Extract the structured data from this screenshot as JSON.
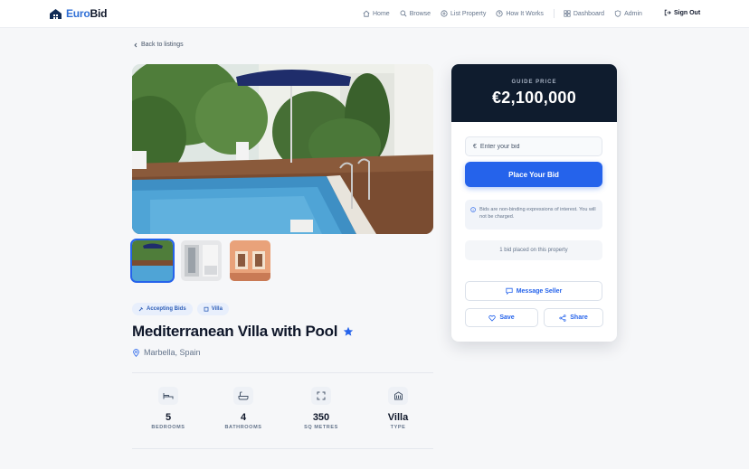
{
  "header": {
    "logo_euro": "Euro",
    "logo_bid": "Bid",
    "nav": [
      {
        "label": "Home",
        "icon": "home-icon"
      },
      {
        "label": "Browse",
        "icon": "search-icon"
      },
      {
        "label": "List Property",
        "icon": "plus-circle-icon"
      },
      {
        "label": "How It Works",
        "icon": "help-circle-icon"
      }
    ],
    "nav_user": [
      {
        "label": "Dashboard",
        "icon": "grid-icon"
      },
      {
        "label": "Admin",
        "icon": "shield-icon"
      }
    ],
    "sign_out": "Sign Out"
  },
  "back_label": "Back to listings",
  "listing": {
    "tags": [
      "Accepting Bids",
      "Villa"
    ],
    "title": "Mediterranean Villa with Pool",
    "location": "Marbella, Spain",
    "stats": [
      {
        "value": "5",
        "label": "BEDROOMS",
        "icon": "bed-icon"
      },
      {
        "value": "4",
        "label": "BATHROOMS",
        "icon": "bath-icon"
      },
      {
        "value": "350",
        "label": "SQ METRES",
        "icon": "expand-icon"
      },
      {
        "value": "Villa",
        "label": "TYPE",
        "icon": "building-icon"
      }
    ]
  },
  "bid_card": {
    "guide_label": "GUIDE PRICE",
    "guide_price": "€2,100,000",
    "currency_symbol": "€",
    "bid_placeholder": "Enter your bid",
    "place_bid": "Place Your Bid",
    "info_text": "Bids are non-binding expressions of interest. You will not be charged.",
    "bids_count": "1 bid placed on this property",
    "message_seller": "Message Seller",
    "save": "Save",
    "share": "Share"
  },
  "colors": {
    "accent": "#2563eb",
    "card_header": "#0f1c2e",
    "tag_bg": "#e8effc"
  }
}
